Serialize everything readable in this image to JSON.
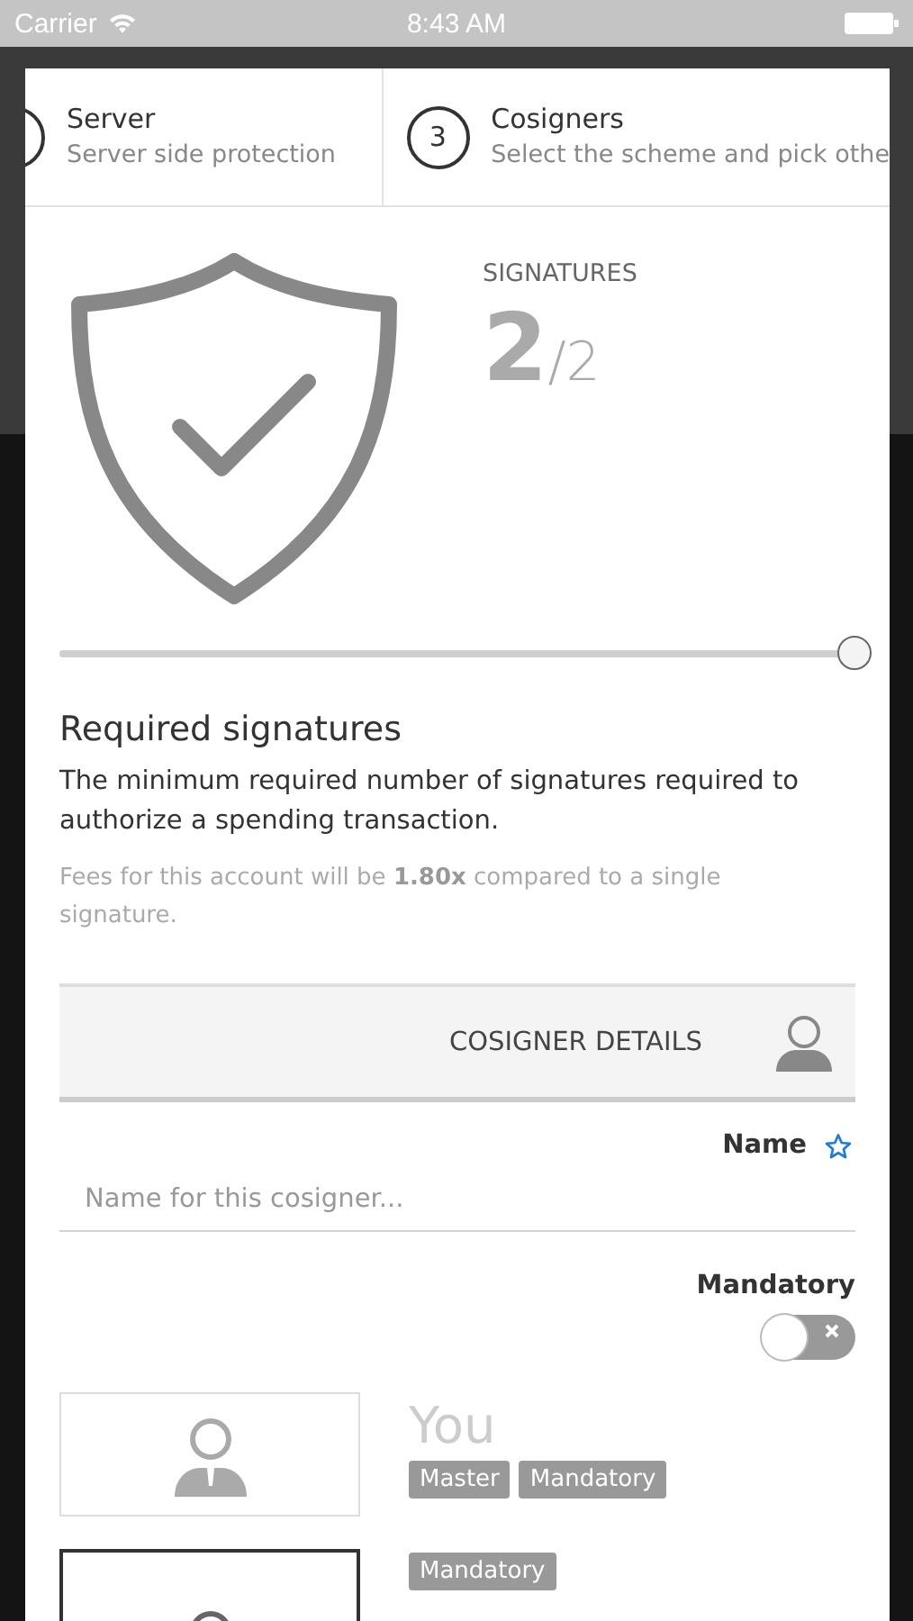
{
  "status_bar": {
    "carrier": "Carrier",
    "time": "8:43 AM"
  },
  "steps": [
    {
      "title": "Server",
      "subtitle": "Server side protection"
    },
    {
      "number": "3",
      "title": "Cosigners",
      "subtitle": "Select the scheme and pick othe"
    }
  ],
  "signatures": {
    "label": "SIGNATURES",
    "count": "2",
    "total": "/2",
    "slider": {
      "level": 1
    }
  },
  "required": {
    "title": "Required signatures",
    "description": "The minimum required number of signatures required to authorize a spending transaction.",
    "fees": "Fees for this account will be **1.80x** compared to a single signature."
  },
  "cosigner_details": {
    "title": "COSIGNER DETAILS"
  },
  "name_field": {
    "label": "Name",
    "placeholder": "Name for this cosigner..."
  },
  "mandatory": {
    "label": "Mandatory",
    "on": false
  },
  "cosigners": [
    {
      "name": "You",
      "selected": false,
      "tags": [
        "Master",
        "Mandatory"
      ]
    },
    {
      "selected": true,
      "tags": [
        "Mandatory"
      ]
    }
  ]
}
